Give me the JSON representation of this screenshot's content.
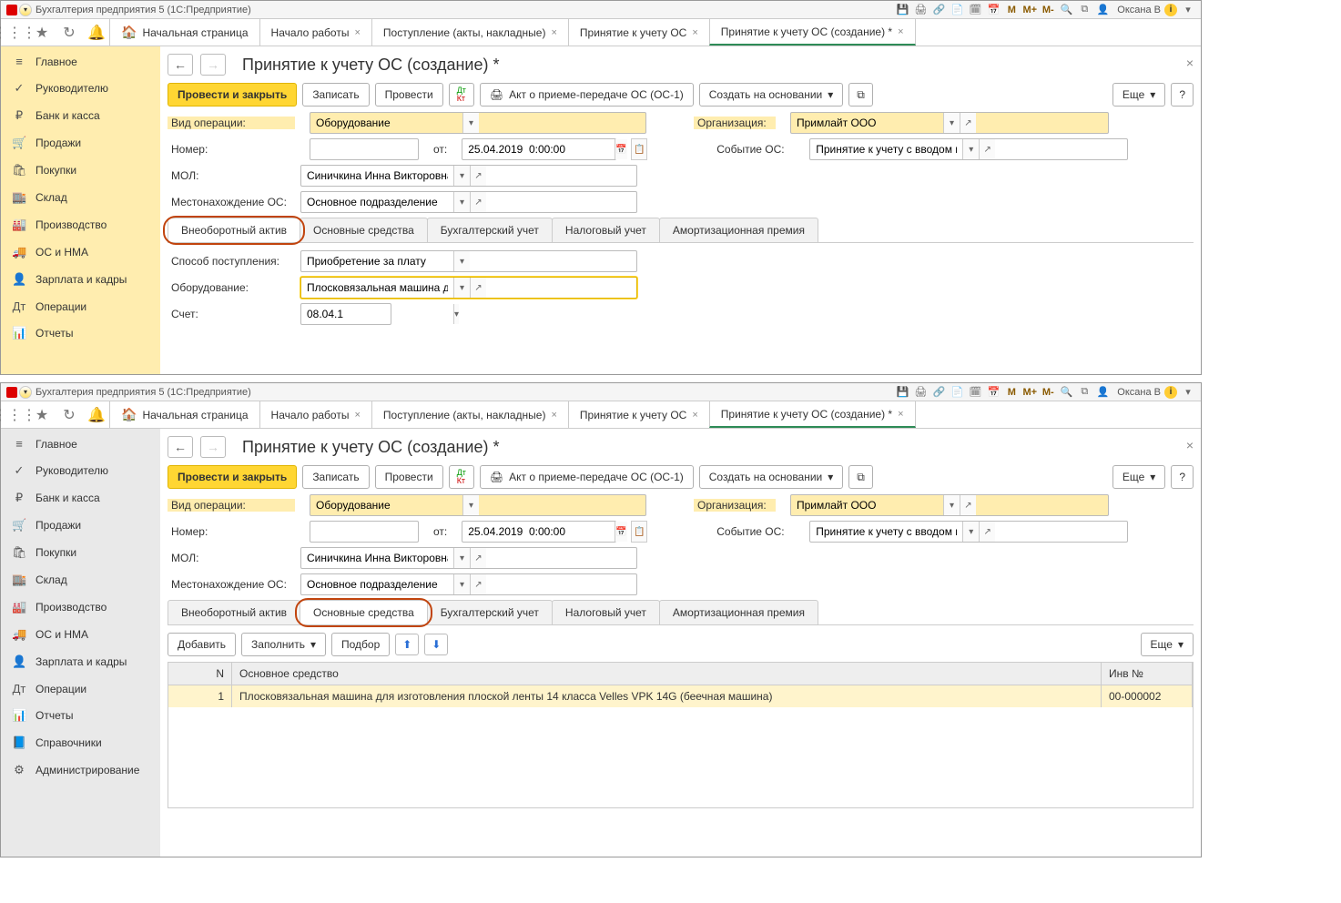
{
  "titlebar": {
    "app_title": "Бухгалтерия предприятия 5   (1С:Предприятие)",
    "user": "Оксана В"
  },
  "top_tabs": {
    "home": "Начальная страница",
    "t1": "Начало работы",
    "t2": "Поступление (акты, накладные)",
    "t3": "Принятие к учету ОС",
    "t4": "Принятие к учету ОС (создание) *"
  },
  "sidebar": {
    "items": [
      {
        "icon": "≡",
        "label": "Главное"
      },
      {
        "icon": "✓",
        "label": "Руководителю"
      },
      {
        "icon": "₽",
        "label": "Банк и касса"
      },
      {
        "icon": "🛒",
        "label": "Продажи"
      },
      {
        "icon": "🛍",
        "label": "Покупки"
      },
      {
        "icon": "🏬",
        "label": "Склад"
      },
      {
        "icon": "🏭",
        "label": "Производство"
      },
      {
        "icon": "🚚",
        "label": "ОС и НМА"
      },
      {
        "icon": "👤",
        "label": "Зарплата и кадры"
      },
      {
        "icon": "Дт",
        "label": "Операции"
      },
      {
        "icon": "📊",
        "label": "Отчеты"
      },
      {
        "icon": "📘",
        "label": "Справочники"
      },
      {
        "icon": "⚙",
        "label": "Администрирование"
      }
    ]
  },
  "page": {
    "title": "Принятие к учету ОС (создание) *",
    "close": "×"
  },
  "toolbar": {
    "post_close": "Провести и закрыть",
    "save": "Записать",
    "post": "Провести",
    "print_form": "Акт о приеме-передаче ОС (ОС-1)",
    "create_based": "Создать на основании",
    "more": "Еще",
    "help": "?"
  },
  "fields": {
    "op_type_label": "Вид операции:",
    "op_type_value": "Оборудование",
    "org_label": "Организация:",
    "org_value": "Примлайт ООО",
    "number_label": "Номер:",
    "ot_label": "от:",
    "date_value": "25.04.2019  0:00:00",
    "event_label": "Событие ОС:",
    "event_value": "Принятие к учету с вводом в эксплуатацию",
    "mol_label": "МОЛ:",
    "mol_value": "Синичкина Инна Викторовна",
    "loc_label": "Местонахождение ОС:",
    "loc_value": "Основное подразделение"
  },
  "inner_tabs": {
    "t1": "Внеоборотный актив",
    "t2": "Основные средства",
    "t3": "Бухгалтерский учет",
    "t4": "Налоговый учет",
    "t5": "Амортизационная премия"
  },
  "pane1": {
    "method_label": "Способ поступления:",
    "method_value": "Приобретение за плату",
    "equip_label": "Оборудование:",
    "equip_value": "Плосковязальная машина для изготовления плоской лент",
    "account_label": "Счет:",
    "account_value": "08.04.1"
  },
  "pane2": {
    "add": "Добавить",
    "fill": "Заполнить",
    "pick": "Подбор",
    "more": "Еще",
    "col_n": "N",
    "col_main": "Основное средство",
    "col_inv": "Инв №",
    "row_n": "1",
    "row_main": "Плосковязальная машина для изготовления плоской ленты 14 класса Velles VPK 14G (беечная машина)",
    "row_inv": "00-000002"
  }
}
